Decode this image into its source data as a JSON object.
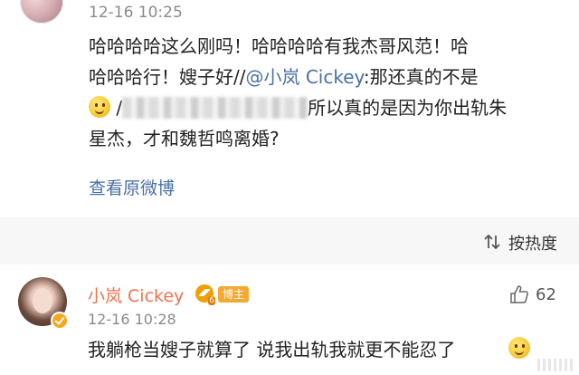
{
  "post": {
    "timestamp": "12-16 10:25",
    "line1": "哈哈哈哈这么刚吗！哈哈哈哈有我杰哥风范！哈",
    "line2a": "哈哈哈行！嫂子好//",
    "mention": "@小岚 Cickey",
    "line2b": ":那还真的不是",
    "line3a": "/",
    "line3b": "所以真的是因为你出轨朱",
    "line4": "星杰，才和魏哲鸣离婚?",
    "view_original": "查看原微博"
  },
  "sort": {
    "label": "按热度",
    "icon": "sort-icon"
  },
  "comment": {
    "username": "小岚 Cickey",
    "badge": "博主",
    "timestamp": "12-16 10:28",
    "text": "我躺枪当嫂子就算了 说我出轨我就更不能忍了",
    "likes": "62",
    "like_icon": "thumbs-up-icon",
    "colors": {
      "username": "#eb7350",
      "badge": "#f4a933",
      "link": "#4a6fa5"
    }
  }
}
